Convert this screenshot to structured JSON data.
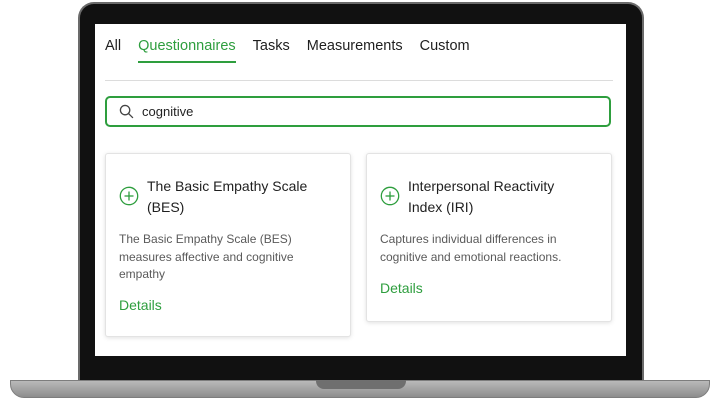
{
  "tabs": [
    {
      "label": "All",
      "active": false
    },
    {
      "label": "Questionnaires",
      "active": true
    },
    {
      "label": "Tasks",
      "active": false
    },
    {
      "label": "Measurements",
      "active": false
    },
    {
      "label": "Custom",
      "active": false
    }
  ],
  "search": {
    "value": "cognitive",
    "icon": "search-icon"
  },
  "cards": [
    {
      "title": "The Basic Empathy Scale (BES)",
      "description": "The Basic Empathy Scale (BES) measures affective and cognitive empathy",
      "details_label": "Details",
      "icon": "add-circle-icon"
    },
    {
      "title": "Interpersonal Reactivity Index (IRI)",
      "description": "Captures individual differences in cognitive and emotional reactions.",
      "details_label": "Details",
      "icon": "add-circle-icon"
    }
  ],
  "colors": {
    "accent": "#2e9e3e",
    "text": "#1f1f1f",
    "muted": "#5a5a5a"
  }
}
